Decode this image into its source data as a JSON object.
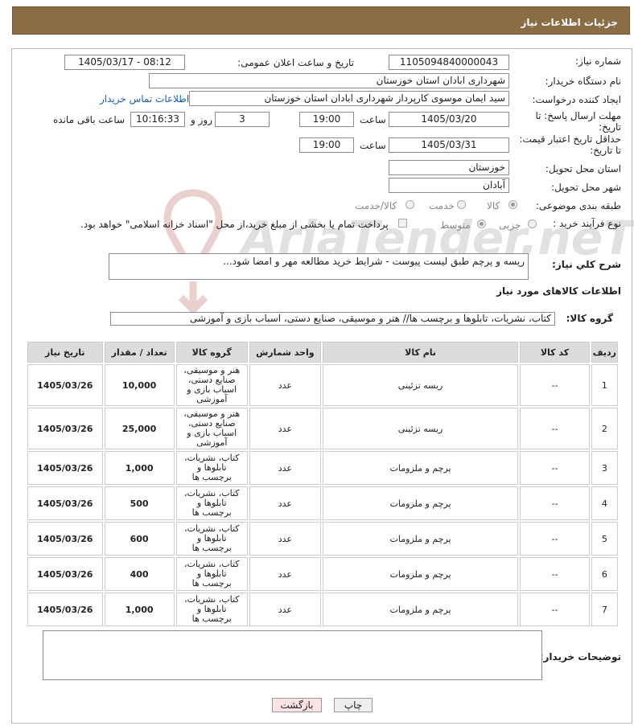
{
  "page": {
    "title": "جزئیات اطلاعات نیاز"
  },
  "form": {
    "need_number_label": "شماره نیاز:",
    "need_number": "1105094840000043",
    "announce_label": "تاریخ و ساعت اعلان عمومی:",
    "announce_value": "1405/03/17 - 08:12",
    "buyer_org_label": "نام دستگاه خریدار:",
    "buyer_org": "شهرداری ابادان استان خوزستان",
    "requester_label": "ایجاد کننده درخواست:",
    "requester": "سید ایمان موسوی کارپرداز شهرداری ابادان استان خوزستان",
    "contact_link": "اطلاعات تماس خریدار",
    "deadline_label": "مهلت ارسال پاسخ: تا تاریخ:",
    "deadline_date": "1405/03/20",
    "time_label": "ساعت",
    "deadline_time": "19:00",
    "days": "3",
    "days_label": "روز و",
    "remaining_time": "10:16:33",
    "remaining_label": "ساعت باقی مانده",
    "price_validity_label": "حداقل تاریخ اعتبار قیمت: تا تاریخ:",
    "price_validity_date": "1405/03/31",
    "price_validity_time": "19:00",
    "province_label": "استان محل تحویل:",
    "province": "خوزستان",
    "city_label": "شهر محل تحویل:",
    "city": "آبادان",
    "category_label": "طبقه بندی موضوعی:",
    "category_options": [
      "کالا",
      "خدمت",
      "کالا/خدمت"
    ],
    "process_label": "نوع فرآیند خرید :",
    "process_options": [
      "جزیی",
      "متوسط"
    ],
    "payment_note": "پرداخت تمام یا بخشی از مبلغ خرید،از محل \"اسناد خزانه اسلامی\" خواهد بود.",
    "description_label": "شرح کلي نياز:",
    "description": "ریسه و پرچم طبق لیست پیوست - شرایط خرید مطالعه مهر و امضا شود...",
    "items_section_title": "اطلاعات کالاهای مورد نیاز",
    "goods_group_label": "گروه کالا:",
    "goods_group": "کتاب، نشریات، تابلوها و برچسب ها// هنر و موسیقی، صنایع دستی، اسباب بازی و آموزشی",
    "buyer_notes_label": "توضیحات خریدار:",
    "buyer_notes": ""
  },
  "table": {
    "headers": [
      "ردیف",
      "کد کالا",
      "نام کالا",
      "واحد شمارش",
      "گروه کالا",
      "تعداد / مقدار",
      "تاریخ نیاز"
    ],
    "rows": [
      [
        "1",
        "--",
        "ریسه تزئینی",
        "عدد",
        "هنر و موسیقی، صنایع دستی، اسباب بازی و آموزشی",
        "10,000",
        "1405/03/26"
      ],
      [
        "2",
        "--",
        "ریسه تزئینی",
        "عدد",
        "هنر و موسیقی، صنایع دستی، اسباب بازی و آموزشی",
        "25,000",
        "1405/03/26"
      ],
      [
        "3",
        "--",
        "پرچم و ملزومات",
        "عدد",
        "کتاب، نشریات، تابلوها و برچسب ها",
        "1,000",
        "1405/03/26"
      ],
      [
        "4",
        "--",
        "پرچم و ملزومات",
        "عدد",
        "کتاب، نشریات، تابلوها و برچسب ها",
        "500",
        "1405/03/26"
      ],
      [
        "5",
        "--",
        "پرچم و ملزومات",
        "عدد",
        "کتاب، نشریات، تابلوها و برچسب ها",
        "600",
        "1405/03/26"
      ],
      [
        "6",
        "--",
        "پرچم و ملزومات",
        "عدد",
        "کتاب، نشریات، تابلوها و برچسب ها",
        "400",
        "1405/03/26"
      ],
      [
        "7",
        "--",
        "پرچم و ملزومات",
        "عدد",
        "کتاب، نشریات، تابلوها و برچسب ها",
        "1,000",
        "1405/03/26"
      ]
    ]
  },
  "buttons": {
    "print": "چاپ",
    "back": "بازگشت"
  },
  "watermark": "AriaTender.neT"
}
